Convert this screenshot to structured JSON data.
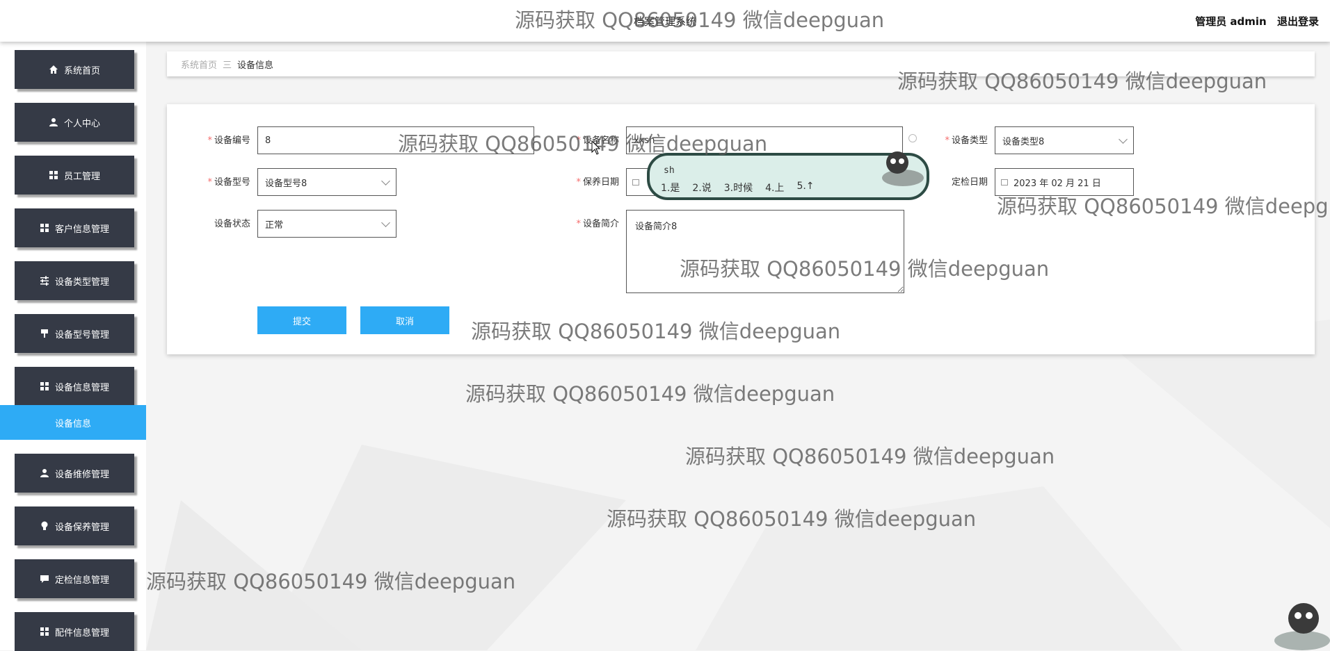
{
  "header": {
    "title": "档案管理系统",
    "user_label": "管理员 admin",
    "logout_label": "退出登录"
  },
  "sidebar": {
    "items": [
      {
        "label": "系统首页",
        "icon": "home-icon"
      },
      {
        "label": "个人中心",
        "icon": "user-icon"
      },
      {
        "label": "员工管理",
        "icon": "grid-icon"
      },
      {
        "label": "客户信息管理",
        "icon": "grid-icon"
      },
      {
        "label": "设备类型管理",
        "icon": "sliders-icon"
      },
      {
        "label": "设备型号管理",
        "icon": "paint-roller-icon"
      },
      {
        "label": "设备信息管理",
        "icon": "grid-icon"
      },
      {
        "label": "设备维修管理",
        "icon": "user-icon"
      },
      {
        "label": "设备保养管理",
        "icon": "lightbulb-icon"
      },
      {
        "label": "定检信息管理",
        "icon": "chat-icon"
      },
      {
        "label": "配件信息管理",
        "icon": "grid-icon"
      }
    ],
    "active_sub": "设备信息"
  },
  "breadcrumb": {
    "home": "系统首页",
    "separator": "三",
    "current": "设备信息"
  },
  "form": {
    "device_no": {
      "label": "设备编号",
      "value": "8"
    },
    "device_name": {
      "label": "设备名称",
      "value": "xxsh"
    },
    "device_type": {
      "label": "设备类型",
      "value": "设备类型8"
    },
    "device_model": {
      "label": "设备型号",
      "value": "设备型号8"
    },
    "maintenance_date": {
      "label": "保养日期",
      "value": ""
    },
    "inspection_date": {
      "label": "定检日期",
      "value": "2023 年 02 月 21 日"
    },
    "device_status": {
      "label": "设备状态",
      "value": "正常"
    },
    "device_intro": {
      "label": "设备简介",
      "value": "设备简介8"
    },
    "required_mark": "*",
    "submit_label": "提交",
    "cancel_label": "取消"
  },
  "ime": {
    "composition": "sh",
    "candidates": [
      "1.是",
      "2.说",
      "3.时候",
      "4.上",
      "5.↑"
    ]
  },
  "watermark": {
    "text": "源码获取 QQ86050149 微信deepguan"
  },
  "colors": {
    "accent": "#2eabf5",
    "sidebar_bg": "#353a46",
    "required": "#f56c6c"
  }
}
